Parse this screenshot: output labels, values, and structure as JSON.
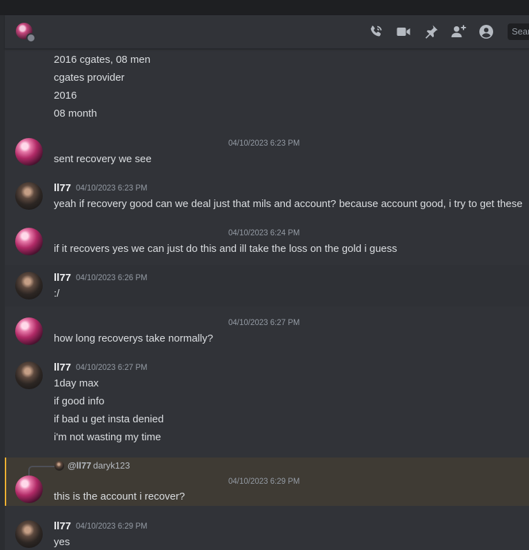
{
  "header": {
    "search_placeholder": "Search"
  },
  "messages": [
    {
      "kind": "continuation",
      "lines": [
        "2016 cgates, 08 men",
        "cgates provider",
        "2016",
        "08 month"
      ]
    },
    {
      "kind": "pink",
      "timestamp": "04/10/2023 6:23 PM",
      "lines": [
        "sent recovery we see"
      ]
    },
    {
      "kind": "user",
      "username": "ll77",
      "timestamp": "04/10/2023 6:23 PM",
      "lines": [
        "yeah if recovery good can we deal just that mils and account? because account good, i try to get these"
      ]
    },
    {
      "kind": "pink",
      "timestamp": "04/10/2023 6:24 PM",
      "lines": [
        "if it recovers yes we can just do this and ill take the loss on the gold i guess"
      ]
    },
    {
      "kind": "user",
      "username": "ll77",
      "timestamp": "04/10/2023 6:26 PM",
      "lines": [
        ":/"
      ]
    },
    {
      "kind": "pink",
      "timestamp": "04/10/2023 6:27 PM",
      "lines": [
        "how long recoverys take normally?"
      ]
    },
    {
      "kind": "user",
      "username": "ll77",
      "timestamp": "04/10/2023 6:27 PM",
      "lines": [
        "1day max",
        "if good info",
        "if bad u get insta denied",
        "i'm not wasting my time"
      ]
    },
    {
      "kind": "pink-reply",
      "reply_to": "@ll77",
      "reply_text": "daryk123",
      "timestamp": "04/10/2023 6:29 PM",
      "lines": [
        "this is the account i recover?"
      ]
    },
    {
      "kind": "user",
      "username": "ll77",
      "timestamp": "04/10/2023 6:29 PM",
      "lines": [
        "yes"
      ]
    }
  ]
}
